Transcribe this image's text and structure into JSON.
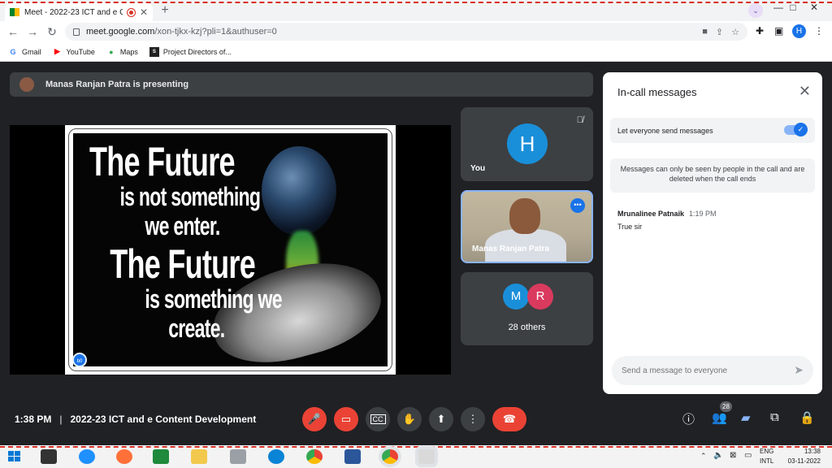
{
  "browser": {
    "tab_title": "Meet - 2022-23 ICT and e Co",
    "tab_close": "✕",
    "new_tab": "+",
    "url_host": "meet.google.com",
    "url_path": "/xon-tjkx-kzj?pli=1&authuser=0",
    "profile_initial": "H",
    "window_controls": [
      "—",
      "□",
      "✕"
    ]
  },
  "bookmarks": [
    {
      "label": "Gmail",
      "icon": "google-icon",
      "color": "#4285f4",
      "glyph": "G"
    },
    {
      "label": "YouTube",
      "icon": "youtube-icon",
      "color": "#ff0000",
      "glyph": "▶"
    },
    {
      "label": "Maps",
      "icon": "maps-icon",
      "color": "#34a853",
      "glyph": "●"
    },
    {
      "label": "Project Directors of...",
      "icon": "sdm-icon",
      "color": "#222222",
      "glyph": "S"
    }
  ],
  "presenting_banner": "Manas Ranjan Patra is presenting",
  "slide": {
    "lines": [
      "The Future",
      "is not something",
      "we enter.",
      "The Future",
      "is something we",
      "create."
    ],
    "badge": "b0"
  },
  "tiles": {
    "you": {
      "initial": "H",
      "name": "You"
    },
    "camera": {
      "name": "Manas Ranjan Patra"
    },
    "others": {
      "initials": [
        "M",
        "R"
      ],
      "colors": [
        "#1a8fd9",
        "#d93a5e"
      ],
      "count_label": "28 others"
    }
  },
  "chat": {
    "title": "In-call messages",
    "toggle_label": "Let everyone send messages",
    "notice": "Messages can only be seen by people in the call and are deleted when the call ends",
    "messages": [
      {
        "sender": "Mrunalinee Patnaik",
        "time": "1:19 PM",
        "text": "True sir"
      }
    ],
    "input_placeholder": "Send a message to everyone"
  },
  "meeting": {
    "time": "1:38 PM",
    "separator": "|",
    "title": "2022-23 ICT and e Content Development",
    "participants_badge": "28"
  },
  "taskbar": {
    "lang_line1": "ENG",
    "lang_line2": "INTL",
    "clock_time": "13:38",
    "clock_date": "03-11-2022"
  }
}
